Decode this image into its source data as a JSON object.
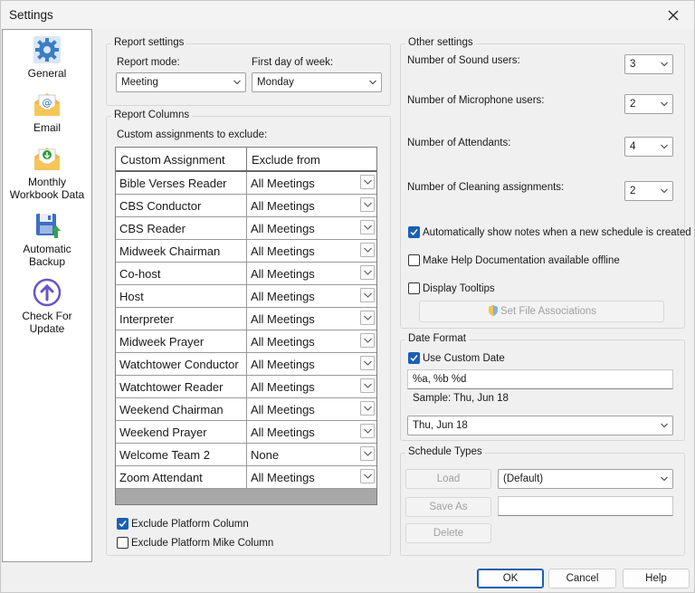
{
  "window": {
    "title": "Settings"
  },
  "sidebar": {
    "items": [
      {
        "label": "General",
        "icon": "gear-icon"
      },
      {
        "label": "Email",
        "icon": "email-icon"
      },
      {
        "label": "Monthly Workbook Data",
        "line1": "Monthly",
        "line2": "Workbook Data",
        "icon": "workbook-download-icon"
      },
      {
        "label": "Automatic Backup",
        "line1": "Automatic",
        "line2": "Backup",
        "icon": "backup-disk-icon"
      },
      {
        "label": "Check For Update",
        "line1": "Check For",
        "line2": "Update",
        "icon": "update-arrow-icon"
      }
    ]
  },
  "report_settings": {
    "legend": "Report settings",
    "mode_label": "Report mode:",
    "mode_value": "Meeting",
    "first_day_label": "First day of week:",
    "first_day_value": "Monday"
  },
  "report_columns": {
    "legend": "Report Columns",
    "exclude_label": "Custom assignments to exclude:",
    "headers": {
      "assignment": "Custom Assignment",
      "exclude": "Exclude from"
    },
    "rows": [
      {
        "assignment": "Bible Verses Reader",
        "exclude": "All Meetings"
      },
      {
        "assignment": "CBS Conductor",
        "exclude": "All Meetings"
      },
      {
        "assignment": "CBS Reader",
        "exclude": "All Meetings"
      },
      {
        "assignment": "Midweek Chairman",
        "exclude": "All Meetings"
      },
      {
        "assignment": "Co-host",
        "exclude": "All Meetings"
      },
      {
        "assignment": "Host",
        "exclude": "All Meetings"
      },
      {
        "assignment": "Interpreter",
        "exclude": "All Meetings"
      },
      {
        "assignment": "Midweek Prayer",
        "exclude": "All Meetings"
      },
      {
        "assignment": "Watchtower Conductor",
        "exclude": "All Meetings"
      },
      {
        "assignment": "Watchtower Reader",
        "exclude": "All Meetings"
      },
      {
        "assignment": "Weekend Chairman",
        "exclude": "All Meetings"
      },
      {
        "assignment": "Weekend Prayer",
        "exclude": "All Meetings"
      },
      {
        "assignment": "Welcome Team 2",
        "exclude": "None"
      },
      {
        "assignment": "Zoom Attendant",
        "exclude": "All Meetings"
      }
    ],
    "exclude_platform": {
      "label": "Exclude Platform Column",
      "checked": true
    },
    "exclude_platform_mike": {
      "label": "Exclude Platform Mike Column",
      "checked": false
    }
  },
  "other_settings": {
    "legend": "Other settings",
    "sound_label": "Number of Sound users:",
    "sound_value": "3",
    "mic_label": "Number of Microphone users:",
    "mic_value": "2",
    "attendants_label": "Number of Attendants:",
    "attendants_value": "4",
    "cleaning_label": "Number of Cleaning assignments:",
    "cleaning_value": "2",
    "auto_notes": {
      "label": "Automatically show notes when a new schedule is created",
      "checked": true
    },
    "help_offline": {
      "label": "Make Help Documentation available offline",
      "checked": false
    },
    "tooltips": {
      "label": "Display Tooltips",
      "checked": false
    },
    "file_assoc_label": "Set File Associations"
  },
  "date_format": {
    "legend": "Date Format",
    "use_custom": {
      "label": "Use Custom Date",
      "checked": true
    },
    "custom_value": "%a, %b %d",
    "sample": "Sample: Thu, Jun 18",
    "preset_value": "Thu, Jun 18"
  },
  "schedule_types": {
    "legend": "Schedule Types",
    "load_label": "Load",
    "type_value": "(Default)",
    "save_as_label": "Save As",
    "save_as_value": "",
    "delete_label": "Delete"
  },
  "footer": {
    "ok": "OK",
    "cancel": "Cancel",
    "help": "Help"
  },
  "colors": {
    "accent": "#1a5fb4",
    "window_bg": "#f0f0f0",
    "sidebar_bg": "#ffffff"
  }
}
